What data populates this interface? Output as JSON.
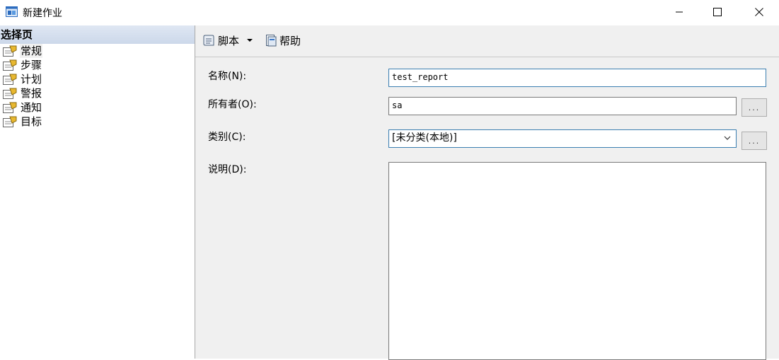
{
  "window": {
    "title": "新建作业"
  },
  "left": {
    "header": "选择页",
    "pages": [
      {
        "label": "常规",
        "selected": true
      },
      {
        "label": "步骤"
      },
      {
        "label": "计划"
      },
      {
        "label": "警报"
      },
      {
        "label": "通知"
      },
      {
        "label": "目标"
      }
    ]
  },
  "toolbar": {
    "script_label": "脚本",
    "help_label": "帮助"
  },
  "form": {
    "name_label": "名称(N):",
    "name_value": "test_report",
    "owner_label": "所有者(O):",
    "owner_value": "sa",
    "category_label": "类别(C):",
    "category_value": "[未分类(本地)]",
    "description_label": "说明(D):",
    "ellipsis": "..."
  },
  "colors": {
    "header_bg": "#ccd8ea",
    "pane_bg": "#f0f0f0",
    "focus_border": "#3c7fb1"
  }
}
